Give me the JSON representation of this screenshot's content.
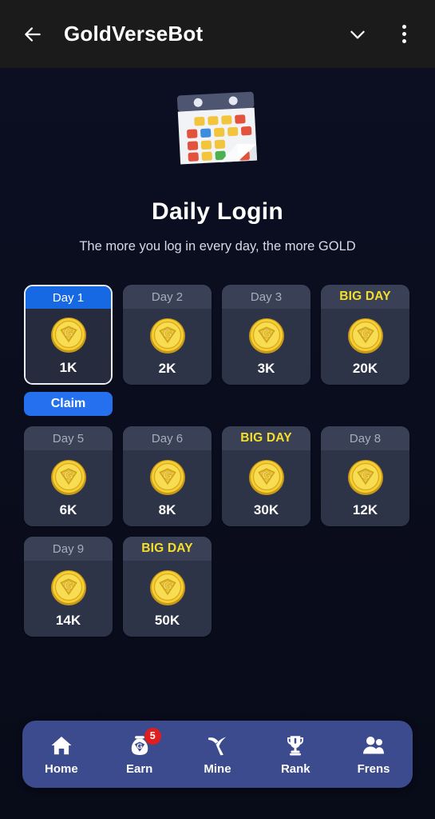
{
  "header": {
    "back_icon": "arrow-left-icon",
    "title": "GoldVerseBot",
    "chevron_icon": "chevron-down-icon",
    "menu_icon": "kebab-menu-icon"
  },
  "hero": {
    "illustration": "calendar-icon",
    "title": "Daily Login",
    "subtitle": "The more you log in every day, the more GOLD"
  },
  "colors": {
    "background": "#0b0e1e",
    "header_bg": "#1b1b1b",
    "card_bg": "#2e3447",
    "card_head_bg": "#3a4156",
    "active_blue": "#1668e3",
    "claim_blue": "#2570ef",
    "big_day_yellow": "#f5df2a",
    "nav_bg": "#3c4a8e",
    "badge_red": "#e01e1e",
    "coin_gold": "#f2c52b"
  },
  "days": [
    {
      "label": "Day 1",
      "amount": "1K",
      "state": "active",
      "big": false,
      "coin": "gold-coin-icon"
    },
    {
      "label": "Day 2",
      "amount": "2K",
      "state": "locked",
      "big": false,
      "coin": "gold-coin-icon"
    },
    {
      "label": "Day 3",
      "amount": "3K",
      "state": "locked",
      "big": false,
      "coin": "gold-coin-icon"
    },
    {
      "label": "BIG DAY",
      "amount": "20K",
      "state": "locked",
      "big": true,
      "coin": "gold-coin-icon"
    },
    {
      "label": "Day 5",
      "amount": "6K",
      "state": "locked",
      "big": false,
      "coin": "gold-coin-icon"
    },
    {
      "label": "Day 6",
      "amount": "8K",
      "state": "locked",
      "big": false,
      "coin": "gold-coin-icon"
    },
    {
      "label": "BIG DAY",
      "amount": "30K",
      "state": "locked",
      "big": true,
      "coin": "gold-coin-icon"
    },
    {
      "label": "Day 8",
      "amount": "12K",
      "state": "locked",
      "big": false,
      "coin": "gold-coin-icon"
    },
    {
      "label": "Day 9",
      "amount": "14K",
      "state": "locked",
      "big": false,
      "coin": "gold-coin-icon"
    },
    {
      "label": "BIG DAY",
      "amount": "50K",
      "state": "locked",
      "big": true,
      "coin": "gold-coin-icon"
    }
  ],
  "claim": {
    "label": "Claim"
  },
  "nav": {
    "items": [
      {
        "label": "Home",
        "icon": "home-icon",
        "badge": null
      },
      {
        "label": "Earn",
        "icon": "money-bag-icon",
        "badge": "5"
      },
      {
        "label": "Mine",
        "icon": "pickaxe-icon",
        "badge": null
      },
      {
        "label": "Rank",
        "icon": "trophy-icon",
        "badge": null
      },
      {
        "label": "Frens",
        "icon": "people-icon",
        "badge": null
      }
    ]
  }
}
